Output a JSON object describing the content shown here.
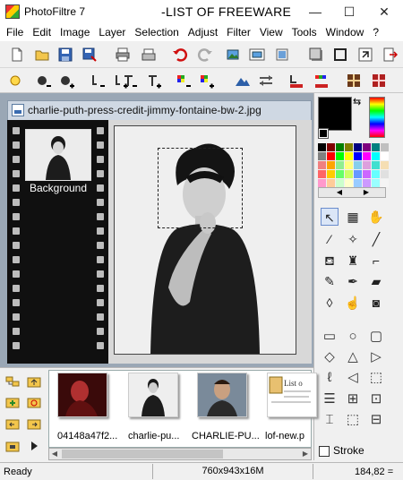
{
  "window": {
    "app_title": "PhotoFiltre 7",
    "doc_title": "-LIST OF FREEWARE",
    "minimize": "—",
    "maximize": "☐",
    "close": "✕"
  },
  "menu": [
    "File",
    "Edit",
    "Image",
    "Layer",
    "Selection",
    "Adjust",
    "Filter",
    "View",
    "Tools",
    "Window",
    "?"
  ],
  "document": {
    "tab_title": "charlie-puth-press-credit-jimmy-fontaine-bw-2.jpg",
    "layer_label": "Background"
  },
  "browser": {
    "files": [
      "04148a47f2...",
      "charlie-pu...",
      "CHARLIE-PU...",
      "lof-new.p"
    ],
    "file4_preview": "List o"
  },
  "palette_colors": [
    "#000000",
    "#800000",
    "#008000",
    "#808000",
    "#000080",
    "#800080",
    "#008080",
    "#c0c0c0",
    "#808080",
    "#ff0000",
    "#00ff00",
    "#ffff00",
    "#0000ff",
    "#ff00ff",
    "#00ffff",
    "#ffffff",
    "#f08080",
    "#ffa500",
    "#90ee90",
    "#ffff80",
    "#87ceeb",
    "#dda0dd",
    "#40e0d0",
    "#f5deb3",
    "#ff6666",
    "#ffcc00",
    "#66ff66",
    "#ccff66",
    "#6699ff",
    "#cc66ff",
    "#66ffff",
    "#e0e0e0",
    "#ff99cc",
    "#ffcc99",
    "#ccffcc",
    "#ffffcc",
    "#99ccff",
    "#cc99ff",
    "#99ffff",
    "#f4f4f4"
  ],
  "panel": {
    "stroke_label": "Stroke",
    "prev_arrow": "◀",
    "next_arrow": "▶"
  },
  "status": {
    "left": "Ready",
    "middle": "760x943x16M",
    "right": "184,82 ="
  }
}
